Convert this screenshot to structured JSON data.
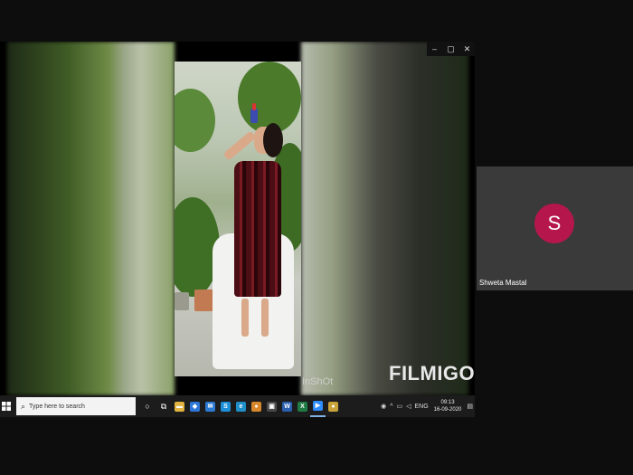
{
  "window": {
    "minimize": "–",
    "maximize": "▢",
    "close": "✕"
  },
  "video": {
    "watermark_inshot": "InShOt",
    "watermark_filmigo": "FILMIGO"
  },
  "taskbar": {
    "search_placeholder": "Type here to search",
    "lang": "ENG",
    "time": "09:13",
    "date": "16-09-2020",
    "apps": [
      {
        "name": "file-explorer",
        "color": "#e3b341",
        "glyph": "▬"
      },
      {
        "name": "dropbox",
        "color": "#2d77d6",
        "glyph": "◆"
      },
      {
        "name": "mail",
        "color": "#2b79d0",
        "glyph": "✉"
      },
      {
        "name": "skype",
        "color": "#1d8fd8",
        "glyph": "S"
      },
      {
        "name": "edge",
        "color": "#1e8fc8",
        "glyph": "e"
      },
      {
        "name": "chrome",
        "color": "#d8872a",
        "glyph": "●"
      },
      {
        "name": "store",
        "color": "#4a4a4a",
        "glyph": "▣"
      },
      {
        "name": "word",
        "color": "#2b5fb0",
        "glyph": "W"
      },
      {
        "name": "excel",
        "color": "#1f7a44",
        "glyph": "X"
      },
      {
        "name": "zoom",
        "color": "#2d8cff",
        "glyph": "▶"
      },
      {
        "name": "chrome-2",
        "color": "#c9a23a",
        "glyph": "●"
      }
    ]
  },
  "participant": {
    "initial": "S",
    "name": "Shweta Mastal"
  }
}
